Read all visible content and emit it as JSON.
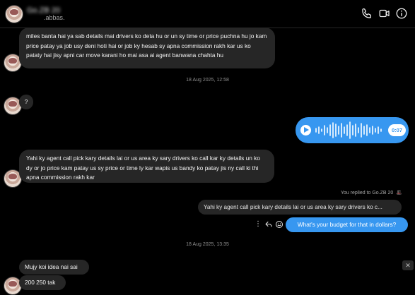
{
  "header": {
    "contact_name": "Go.ZB 20",
    "handle": ".abbas.",
    "icons": [
      "phone-icon",
      "video-camera-icon",
      "info-icon"
    ]
  },
  "messages": {
    "m1": "miles banta hai ya sab details mai drivers ko deta hu or un sy time or price puchna hu jo kam price patay ya job usy deni hoti hai or job ky hesab sy apna commission rakh kar us ko pataty hai jisy apni car move karani ho mai asa ai agent banwana chahta hu",
    "time1": "18 Aug 2025, 12:58",
    "m2": "?",
    "voice_duration": "0:07",
    "m3": "Yahi ky agent call pick kary details lai or us area ky sary drivers ko call kar ky details un ko dy or jo price kam patay us sy price or time ly kar wapis us bandy ko patay jis ny call ki thi apna commission rakh kar",
    "replied_label": "You replied to Go.ZB 20",
    "quoted": "Yahi ky agent call pick kary details lai or us area ky sary drivers ko c...",
    "reply": "What's your budget for that in dollars?",
    "time2": "18 Aug 2025, 13:35",
    "m4": "Mujy koi idea nai sai",
    "m5": "200 250 tak"
  },
  "colors": {
    "accent": "#3797f0",
    "bubble": "#262626",
    "background": "#000000"
  }
}
